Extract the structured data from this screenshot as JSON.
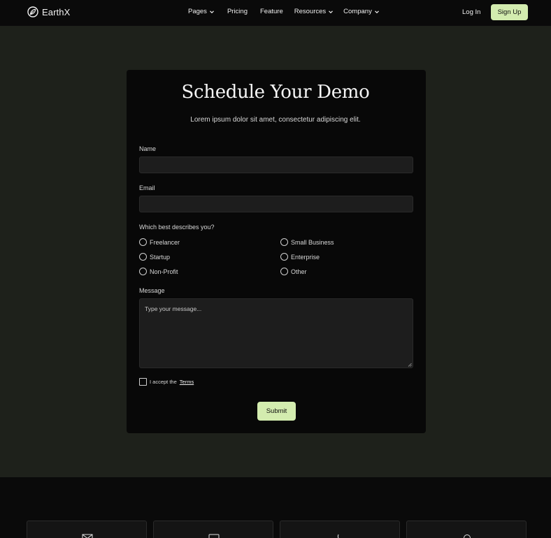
{
  "brand": {
    "name": "EarthX",
    "icon": "leaf-icon"
  },
  "nav": {
    "items": [
      {
        "label": "Pages",
        "dropdown": true
      },
      {
        "label": "Pricing",
        "dropdown": false
      },
      {
        "label": "Feature",
        "dropdown": false
      },
      {
        "label": "Resources",
        "dropdown": true
      },
      {
        "label": "Company",
        "dropdown": true
      }
    ],
    "login_label": "Log In",
    "signup_label": "Sign Up"
  },
  "form": {
    "title": "Schedule Your Demo",
    "subtitle": "Lorem ipsum dolor sit amet, consectetur adipiscing elit.",
    "name_label": "Name",
    "name_value": "",
    "email_label": "Email",
    "email_value": "",
    "describe_label": "Which best describes you?",
    "options": [
      "Freelancer",
      "Small Business",
      "Startup",
      "Enterprise",
      "Non-Profit",
      "Other"
    ],
    "message_label": "Message",
    "message_placeholder": "Type your message...",
    "terms_text": "I accept the",
    "terms_link": "Terms",
    "submit_label": "Submit"
  },
  "footer": {
    "contact_icons": [
      "mail-icon",
      "chat-icon",
      "phone-icon",
      "location-icon"
    ]
  },
  "colors": {
    "accent": "#d3ecaf",
    "page_bg": "#1e211b",
    "card_bg": "#080808",
    "navbar_bg": "#0a0a0a"
  }
}
